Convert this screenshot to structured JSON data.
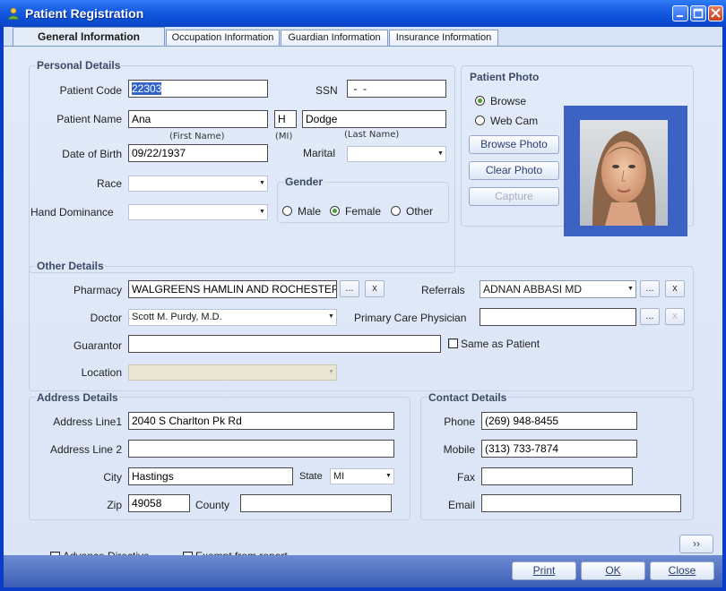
{
  "window": {
    "title": "Patient Registration"
  },
  "tabs": [
    {
      "label": "General Information"
    },
    {
      "label": "Occupation Information"
    },
    {
      "label": "Guardian Information"
    },
    {
      "label": "Insurance Information"
    }
  ],
  "personal": {
    "title": "Personal Details",
    "patient_code_label": "Patient Code",
    "patient_code": "22303",
    "ssn_label": "SSN",
    "ssn": " -  -",
    "patient_name_label": "Patient Name",
    "first_name": "Ana",
    "mi": "H",
    "last_name": "Dodge",
    "first_hint": "(First Name)",
    "mi_hint": "(MI)",
    "last_hint": "(Last Name)",
    "dob_label": "Date of Birth",
    "dob": "09/22/1937",
    "marital_label": "Marital",
    "marital": "",
    "race_label": "Race",
    "race": "",
    "hand_label": "Hand Dominance",
    "hand": "",
    "gender_title": "Gender",
    "gender_options": [
      "Male",
      "Female",
      "Other"
    ],
    "gender_selected": "Female"
  },
  "photo": {
    "title": "Patient Photo",
    "source_options": [
      "Browse",
      "Web Cam"
    ],
    "source_selected": "Browse",
    "browse_button": "Browse Photo",
    "clear_button": "Clear Photo",
    "capture_button": "Capture"
  },
  "other": {
    "title": "Other Details",
    "pharmacy_label": "Pharmacy",
    "pharmacy": "WALGREENS HAMLIN AND ROCHESTER",
    "more_label": "...",
    "clear_label": "x",
    "referrals_label": "Referrals",
    "referrals": "ADNAN  ABBASI MD",
    "doctor_label": "Doctor",
    "doctor": "Scott  M.  Purdy, M.D.",
    "pcp_label": "Primary Care Physician",
    "pcp": "",
    "guarantor_label": "Guarantor",
    "guarantor": "",
    "same_as_patient": "Same as Patient",
    "location_label": "Location",
    "location": ""
  },
  "address": {
    "title": "Address Details",
    "line1_label": "Address Line1",
    "line1": "2040 S Charlton Pk Rd",
    "line2_label": "Address Line 2",
    "line2": "",
    "city_label": "City",
    "city": "Hastings",
    "state_label": "State",
    "state": "MI",
    "zip_label": "Zip",
    "zip": "49058",
    "county_label": "County",
    "county": ""
  },
  "contact": {
    "title": "Contact Details",
    "phone_label": "Phone",
    "phone": "(269) 948-8455",
    "mobile_label": "Mobile",
    "mobile": "(313) 733-7874",
    "fax_label": "Fax",
    "fax": "",
    "email_label": "Email",
    "email": ""
  },
  "footer": {
    "advance_directive": "Advance Directive",
    "exempt": "Exempt from report",
    "next": "››",
    "print": "Print",
    "ok": "OK",
    "close": "Close"
  },
  "colors": {
    "titlebar": "#0d4fd8",
    "page_bg": "#dbe5f6",
    "group_title": "#3c4a66",
    "radio_dot": "#4aa02c",
    "photo_frame": "#3c63c4"
  }
}
